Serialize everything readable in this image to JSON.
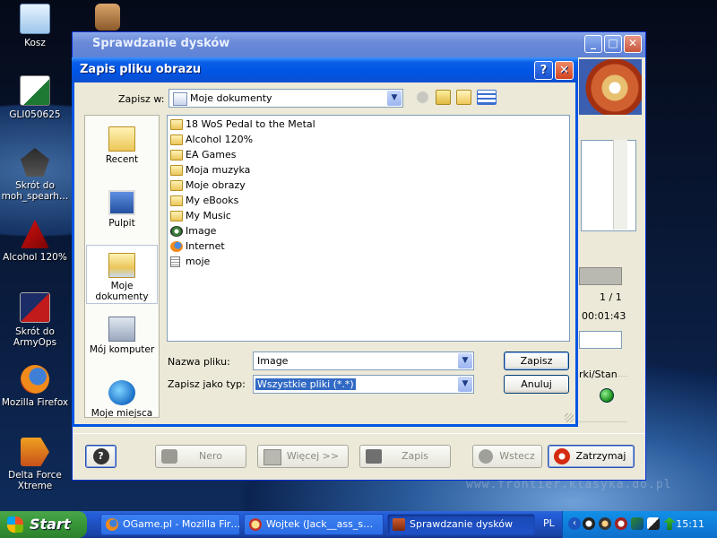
{
  "desktop": {
    "icons": [
      {
        "label": "Kosz",
        "icon": "recycle-bin-icon"
      },
      {
        "label": "GLI050625",
        "icon": "excel-file-icon"
      },
      {
        "label": "Skrót do moh_spearh…",
        "icon": "medal-of-honor-icon"
      },
      {
        "label": "Alcohol 120%",
        "icon": "alcohol-120-icon"
      },
      {
        "label": "Skrót do ArmyOps",
        "icon": "army-ops-icon"
      },
      {
        "label": "Mozilla Firefox",
        "icon": "firefox-icon"
      },
      {
        "label": "Delta Force Xtreme",
        "icon": "delta-force-icon"
      }
    ],
    "watermark": "www.frontier.klasyka.do.pl"
  },
  "main_window": {
    "title": "Sprawdzanie dysków",
    "counter": "1 / 1",
    "elapsed": "00:01:43",
    "status_label": "rki/Stan",
    "toolbar": {
      "help_icon": "help-icon",
      "nero": "Nero",
      "more": "Więcej >>",
      "save": "Zapis",
      "back": "Wstecz",
      "stop": "Zatrzymaj"
    }
  },
  "dialog": {
    "title": "Zapis pliku obrazu",
    "save_in_label": "Zapisz w:",
    "save_in_value": "Moje dokumenty",
    "places": [
      {
        "label": "Recent",
        "icon": "recent-folder-icon",
        "selected": false
      },
      {
        "label": "Pulpit",
        "icon": "desktop-icon",
        "selected": false
      },
      {
        "label": "Moje dokumenty",
        "icon": "my-documents-icon",
        "selected": true
      },
      {
        "label": "Mój komputer",
        "icon": "my-computer-icon",
        "selected": false
      },
      {
        "label": "Moje miejsca",
        "icon": "network-places-icon",
        "selected": false
      }
    ],
    "files": [
      {
        "name": "18 WoS Pedal to the Metal",
        "type": "folder"
      },
      {
        "name": "Alcohol 120%",
        "type": "folder"
      },
      {
        "name": "EA Games",
        "type": "folder"
      },
      {
        "name": "Moja muzyka",
        "type": "folder"
      },
      {
        "name": "Moje obrazy",
        "type": "folder"
      },
      {
        "name": "My eBooks",
        "type": "folder"
      },
      {
        "name": "My Music",
        "type": "folder"
      },
      {
        "name": "Image",
        "type": "image-file"
      },
      {
        "name": "Internet",
        "type": "internet-shortcut"
      },
      {
        "name": "moje",
        "type": "text-file"
      }
    ],
    "filename_label": "Nazwa pliku:",
    "filename_value": "Image",
    "filetype_label": "Zapisz jako typ:",
    "filetype_value": "Wszystkie pliki (*.*)",
    "save_button": "Zapisz",
    "cancel_button": "Anuluj",
    "help_glyph": "?",
    "close_glyph": "✕"
  },
  "taskbar": {
    "start_label": "Start",
    "tasks": [
      {
        "label": "OGame.pl - Mozilla Fir…",
        "active": false
      },
      {
        "label": "Wojtek (Jack__ass_s…",
        "active": false
      },
      {
        "label": "Sprawdzanie dysków",
        "active": true
      }
    ],
    "language": "PL",
    "clock": "15:11"
  },
  "colors": {
    "xp_blue": "#0054e3",
    "dialog_face": "#ece9d8",
    "selection": "#316ac5",
    "start_green": "#3a9a3a"
  }
}
